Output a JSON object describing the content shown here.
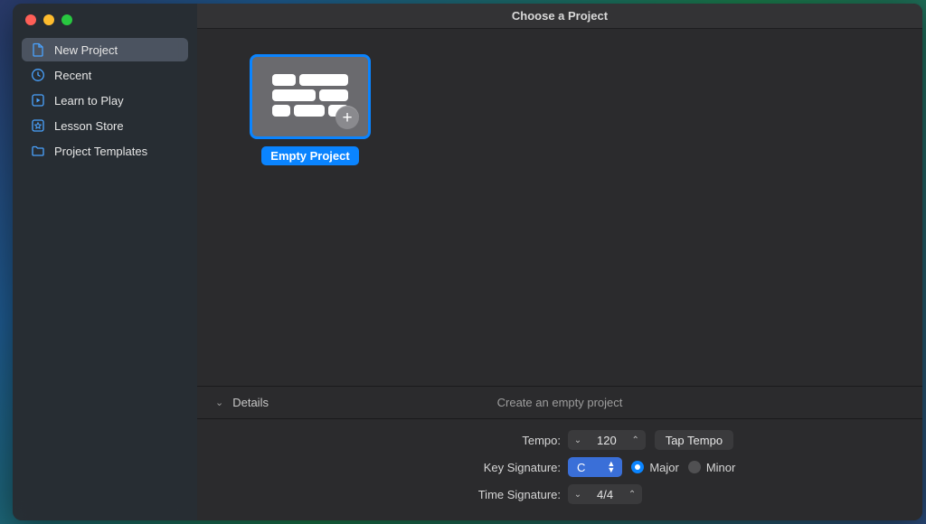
{
  "window": {
    "title": "Choose a Project"
  },
  "sidebar": {
    "items": [
      {
        "label": "New Project"
      },
      {
        "label": "Recent"
      },
      {
        "label": "Learn to Play"
      },
      {
        "label": "Lesson Store"
      },
      {
        "label": "Project Templates"
      }
    ]
  },
  "gallery": {
    "tile_label": "Empty Project"
  },
  "details": {
    "header": "Details",
    "description": "Create an empty project",
    "tempo_label": "Tempo:",
    "tempo_value": "120",
    "tap_tempo": "Tap Tempo",
    "key_label": "Key Signature:",
    "key_value": "C",
    "major": "Major",
    "minor": "Minor",
    "time_label": "Time Signature:",
    "time_value": "4/4"
  }
}
